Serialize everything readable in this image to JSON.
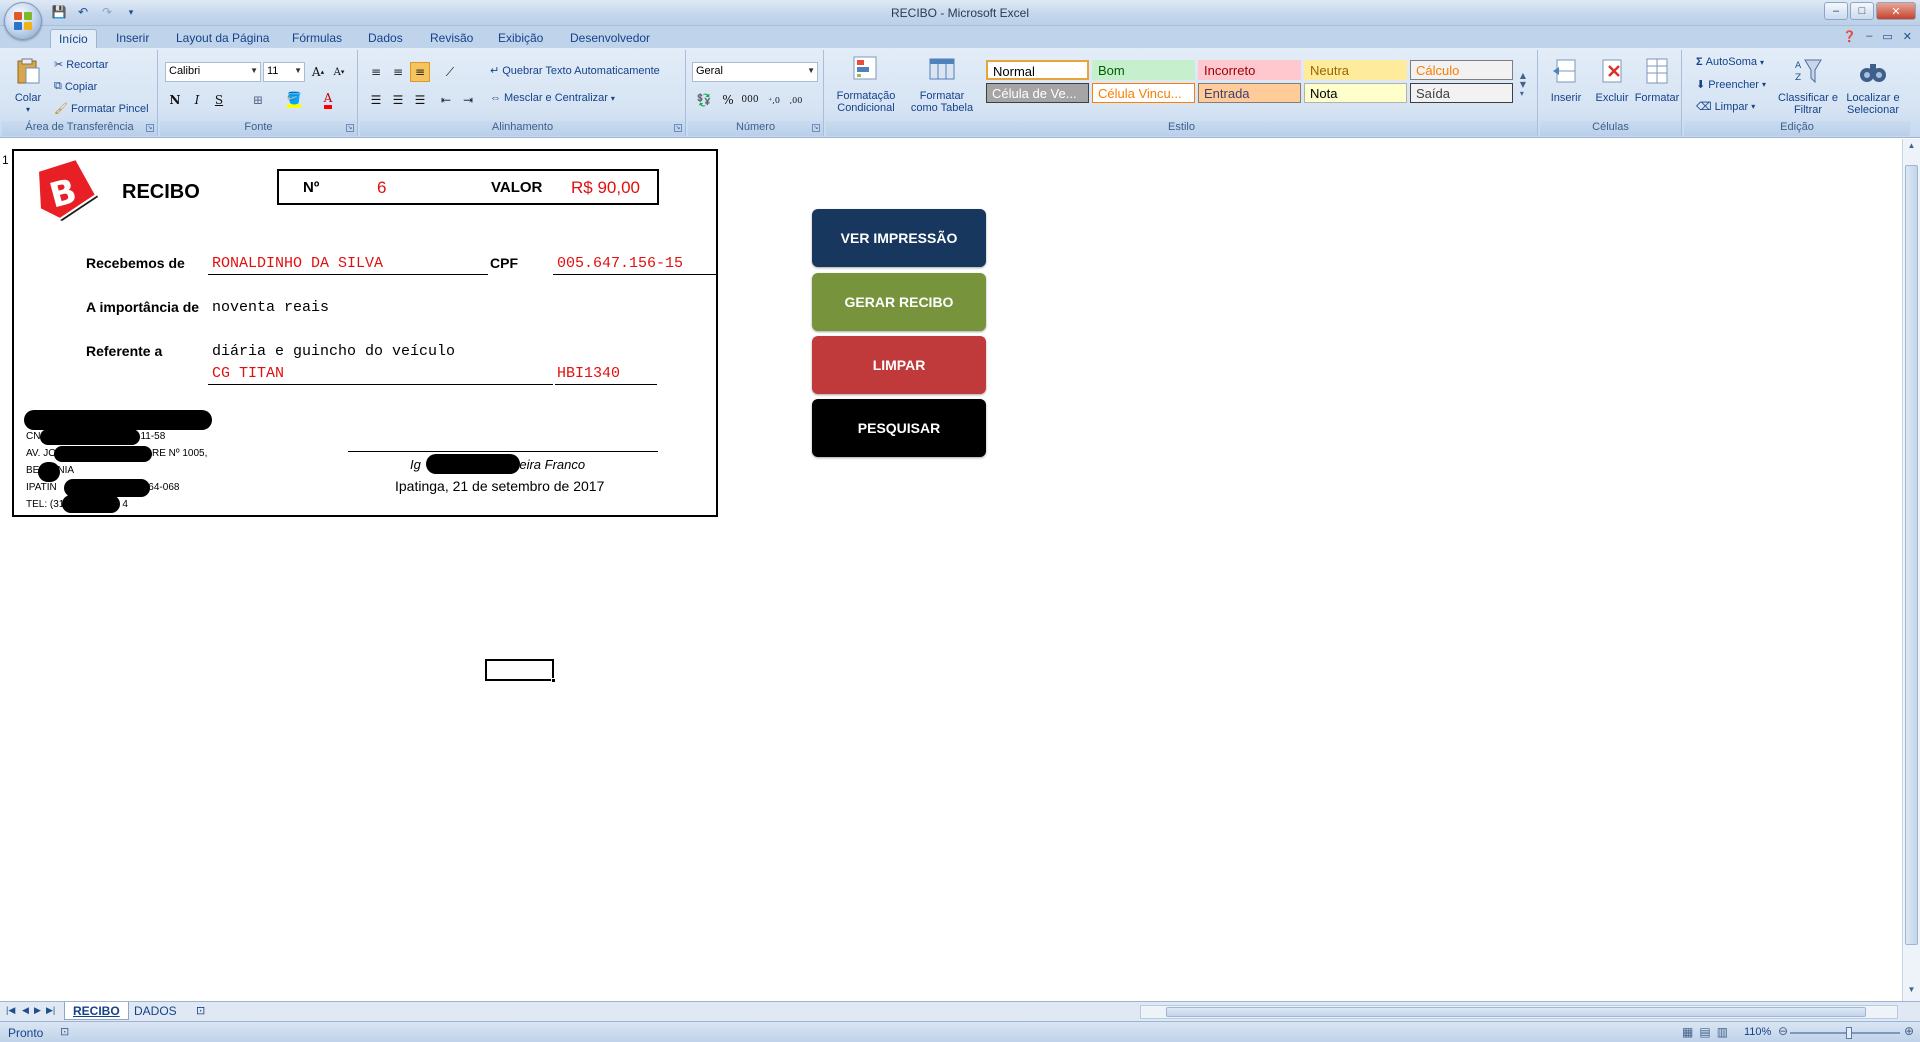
{
  "window": {
    "title": "RECIBO - Microsoft Excel"
  },
  "tabs": [
    "Início",
    "Inserir",
    "Layout da Página",
    "Fórmulas",
    "Dados",
    "Revisão",
    "Exibição",
    "Desenvolvedor"
  ],
  "active_tab": "Início",
  "ribbon": {
    "clipboard": {
      "paste": "Colar",
      "cut": "Recortar",
      "copy": "Copiar",
      "format_painter": "Formatar Pincel",
      "group_label": "Área de Transferência"
    },
    "font": {
      "name": "Calibri",
      "size": "11",
      "group_label": "Fonte"
    },
    "alignment": {
      "wrap_text": "Quebrar Texto Automaticamente",
      "merge_center": "Mesclar e Centralizar",
      "group_label": "Alinhamento"
    },
    "number": {
      "format": "Geral",
      "group_label": "Número"
    },
    "styles": {
      "conditional": "Formatação Condicional",
      "as_table": "Formatar como Tabela",
      "cells": [
        {
          "label": "Normal",
          "bg": "#ffffff",
          "fg": "#000000",
          "border": "#e8a33a"
        },
        {
          "label": "Bom",
          "bg": "#c6efce",
          "fg": "#006100",
          "border": "#c6efce"
        },
        {
          "label": "Incorreto",
          "bg": "#ffc7ce",
          "fg": "#9c0006",
          "border": "#ffc7ce"
        },
        {
          "label": "Neutra",
          "bg": "#ffeb9c",
          "fg": "#9c6500",
          "border": "#ffeb9c"
        },
        {
          "label": "Cálculo",
          "bg": "#f2f2f2",
          "fg": "#fa7d00",
          "border": "#7f7f7f"
        },
        {
          "label": "Célula de Ve...",
          "bg": "#a5a5a5",
          "fg": "#ffffff",
          "border": "#3f3f3f"
        },
        {
          "label": "Célula Vincu...",
          "bg": "#ffffff",
          "fg": "#fa7d00",
          "border": "#ff8001"
        },
        {
          "label": "Entrada",
          "bg": "#ffcc99",
          "fg": "#3f3f76",
          "border": "#7f7f7f"
        },
        {
          "label": "Nota",
          "bg": "#ffffcc",
          "fg": "#000000",
          "border": "#b2b2b2"
        },
        {
          "label": "Saída",
          "bg": "#f2f2f2",
          "fg": "#3f3f3f",
          "border": "#3f3f3f"
        }
      ],
      "group_label": "Estilo"
    },
    "cells": {
      "insert": "Inserir",
      "delete": "Excluir",
      "format": "Formatar",
      "group_label": "Células"
    },
    "editing": {
      "autosum": "AutoSoma",
      "fill": "Preencher",
      "clear": "Limpar",
      "sort_filter": "Classificar e Filtrar",
      "find_select": "Localizar e Selecionar",
      "group_label": "Edição"
    }
  },
  "sheet": {
    "row_number": "1",
    "receipt": {
      "title": "RECIBO",
      "number_label": "Nº",
      "number_value": "6",
      "valor_label": "VALOR",
      "valor_value": "R$ 90,00",
      "received_from_label": "Recebemos de",
      "received_from_value": "RONALDINHO DA SILVA",
      "cpf_label": "CPF",
      "cpf_value": "005.647.156-15",
      "amount_label": "A importância de",
      "amount_value": "noventa reais",
      "reference_label": "Referente a",
      "reference_value": "diária e guincho do veículo",
      "vehicle_model": "CG TITAN",
      "vehicle_plate": "HBI1340",
      "company_lines": [
        "CN",
        "11-58",
        "AV. JO",
        "RE Nº 1005,",
        "BE",
        "NIA",
        "IPATIN",
        "164-068",
        "TEL: (31",
        "4"
      ],
      "signer_left": "Ig",
      "signer_right": "veira Franco",
      "place_date": "Ipatinga, 21 de setembro de 2017"
    },
    "buttons": {
      "print_preview": "VER IMPRESSÃO",
      "generate": "GERAR RECIBO",
      "clear": "LIMPAR",
      "search": "PESQUISAR"
    },
    "button_colors": {
      "print_preview": "#17375e",
      "generate": "#77933c",
      "clear": "#c0393b",
      "search": "#000000"
    }
  },
  "sheet_tabs": [
    "RECIBO",
    "DADOS"
  ],
  "active_sheet": "RECIBO",
  "status": {
    "text": "Pronto",
    "zoom": "110%"
  }
}
